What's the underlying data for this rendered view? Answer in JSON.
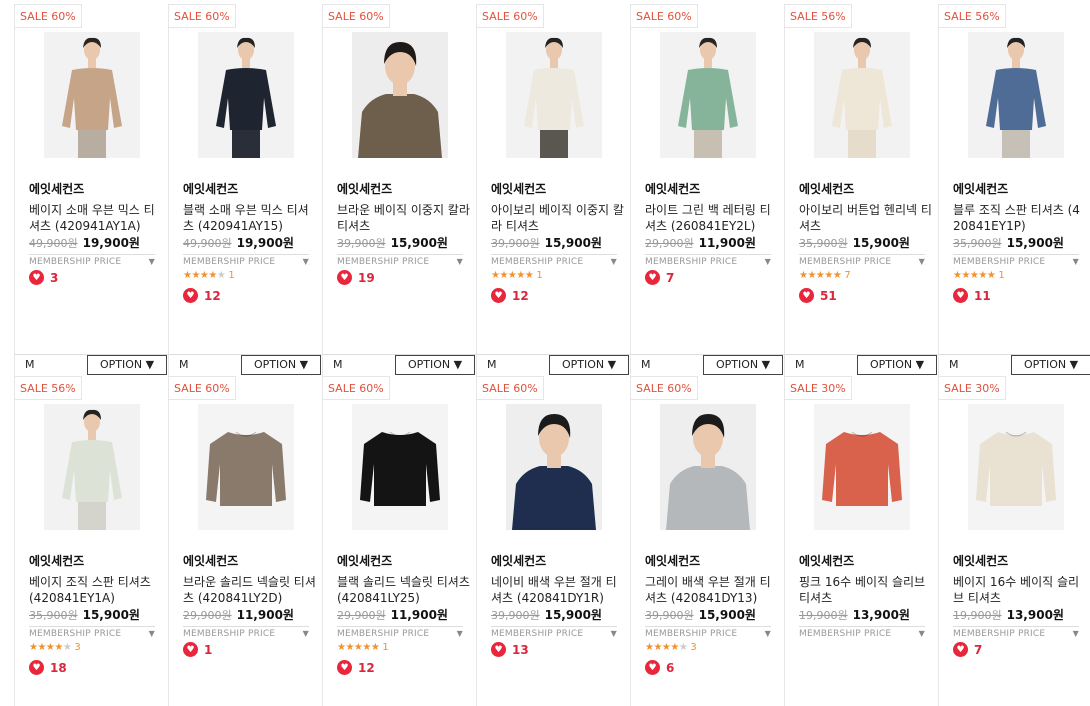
{
  "membership_label": "MEMBERSHIP PRICE",
  "option_label": "OPTION ▼",
  "products": [
    {
      "sale": "SALE 60%",
      "brand": "에잇세컨즈",
      "name": "베이지 소매 우븐 믹스 티셔츠 (420941AY1A)",
      "orig": "49,900원",
      "price": "19,900원",
      "rating": 0,
      "reviews": "",
      "likes": "3",
      "size": "M",
      "colors": {
        "top": "#c5a487",
        "bg": "#f2f2f2",
        "skin": "#e9c8ad",
        "hair": "#2a2420",
        "pants": "#b7ada0"
      },
      "style": "model"
    },
    {
      "sale": "SALE 60%",
      "brand": "에잇세컨즈",
      "name": "블랙 소매 우븐 믹스 티셔츠 (420941AY15)",
      "orig": "49,900원",
      "price": "19,900원",
      "rating": 4,
      "reviews": "1",
      "likes": "12",
      "size": "M",
      "colors": {
        "top": "#1e2430",
        "bg": "#f2f2f2",
        "skin": "#e9c8ad",
        "hair": "#222",
        "pants": "#2a2e38"
      },
      "style": "model"
    },
    {
      "sale": "SALE 60%",
      "brand": "에잇세컨즈",
      "name": "브라운 베이직 이중지 칼라 티셔츠",
      "orig": "39,900원",
      "price": "15,900원",
      "rating": 0,
      "reviews": "",
      "likes": "19",
      "size": "M",
      "colors": {
        "top": "#6e5e4c",
        "bg": "#ededed",
        "skin": "#e9c8ad",
        "hair": "#1f1a17",
        "pants": "#6e5e4c"
      },
      "style": "close"
    },
    {
      "sale": "SALE 60%",
      "brand": "에잇세컨즈",
      "name": "아이보리 베이직 이중지 칼라 티셔츠",
      "orig": "39,900원",
      "price": "15,900원",
      "rating": 5,
      "reviews": "1",
      "likes": "12",
      "size": "M",
      "colors": {
        "top": "#ede9df",
        "bg": "#f2f2f2",
        "skin": "#e9c8ad",
        "hair": "#222",
        "pants": "#5a5650"
      },
      "style": "model"
    },
    {
      "sale": "SALE 60%",
      "brand": "에잇세컨즈",
      "name": "라이트 그린 백 레터링 티셔츠 (260841EY2L)",
      "orig": "29,900원",
      "price": "11,900원",
      "rating": 0,
      "reviews": "",
      "likes": "7",
      "size": "M",
      "colors": {
        "top": "#86b49b",
        "bg": "#f2f2f2",
        "skin": "#e9c8ad",
        "hair": "#2a2420",
        "pants": "#c7c0b2"
      },
      "style": "model"
    },
    {
      "sale": "SALE 56%",
      "brand": "에잇세컨즈",
      "name": "아이보리 버튼업 헨리넥 티셔츠",
      "orig": "35,900원",
      "price": "15,900원",
      "rating": 5,
      "reviews": "7",
      "likes": "51",
      "size": "M",
      "colors": {
        "top": "#eee6d6",
        "bg": "#f2f2f2",
        "skin": "#e9c8ad",
        "hair": "#2a2420",
        "pants": "#e6dccb"
      },
      "style": "model"
    },
    {
      "sale": "SALE 56%",
      "brand": "에잇세컨즈",
      "name": "블루 조직 스판 티셔츠 (420841EY1P)",
      "orig": "35,900원",
      "price": "15,900원",
      "rating": 5,
      "reviews": "1",
      "likes": "11",
      "size": "M",
      "colors": {
        "top": "#4e6c96",
        "bg": "#f2f2f2",
        "skin": "#e9c8ad",
        "hair": "#222",
        "pants": "#c6c0b6"
      },
      "style": "model"
    },
    {
      "sale": "SALE 56%",
      "brand": "에잇세컨즈",
      "name": "베이지 조직 스판 티셔츠 (420841EY1A)",
      "orig": "35,900원",
      "price": "15,900원",
      "rating": 4,
      "reviews": "3",
      "likes": "18",
      "size": "",
      "colors": {
        "top": "#dde2d6",
        "bg": "#f2f2f2",
        "skin": "#e9c8ad",
        "hair": "#222",
        "pants": "#d4d4cc"
      },
      "style": "model"
    },
    {
      "sale": "SALE 60%",
      "brand": "에잇세컨즈",
      "name": "브라운 솔리드 넥슬릿 티셔츠 (420841LY2D)",
      "orig": "29,900원",
      "price": "11,900원",
      "rating": 0,
      "reviews": "",
      "likes": "1",
      "size": "",
      "colors": {
        "top": "#8a7a6c",
        "bg": "#f4f4f4"
      },
      "style": "flat"
    },
    {
      "sale": "SALE 60%",
      "brand": "에잇세컨즈",
      "name": "블랙 솔리드 넥슬릿 티셔츠 (420841LY25)",
      "orig": "29,900원",
      "price": "11,900원",
      "rating": 5,
      "reviews": "1",
      "likes": "12",
      "size": "",
      "colors": {
        "top": "#141414",
        "bg": "#f4f4f4"
      },
      "style": "flat"
    },
    {
      "sale": "SALE 60%",
      "brand": "에잇세컨즈",
      "name": "네이비 배색 우븐 절개 티셔츠 (420841DY1R)",
      "orig": "39,900원",
      "price": "15,900원",
      "rating": 0,
      "reviews": "",
      "likes": "13",
      "size": "",
      "colors": {
        "top": "#1f2e4e",
        "bg": "#eeeeee",
        "skin": "#e9c8ad",
        "hair": "#1b1b1b",
        "pants": "#1f2e4e"
      },
      "style": "close"
    },
    {
      "sale": "SALE 60%",
      "brand": "에잇세컨즈",
      "name": "그레이 배색 우븐 절개 티셔츠 (420841DY13)",
      "orig": "39,900원",
      "price": "15,900원",
      "rating": 4,
      "reviews": "3",
      "likes": "6",
      "size": "",
      "colors": {
        "top": "#b4b8bb",
        "bg": "#eeeeee",
        "skin": "#e9c8ad",
        "hair": "#1b1b1b",
        "pants": "#b4b8bb"
      },
      "style": "close"
    },
    {
      "sale": "SALE 30%",
      "brand": "에잇세컨즈",
      "name": "핑크 16수 베이직 슬리브 티셔츠",
      "orig": "19,900원",
      "price": "13,900원",
      "rating": 0,
      "reviews": "",
      "likes": "",
      "size": "",
      "colors": {
        "top": "#d8624c",
        "bg": "#f4f4f4"
      },
      "style": "flat"
    },
    {
      "sale": "SALE 30%",
      "brand": "에잇세컨즈",
      "name": "베이지 16수 베이직 슬리브 티셔츠",
      "orig": "19,900원",
      "price": "13,900원",
      "rating": 0,
      "reviews": "",
      "likes": "7",
      "size": "",
      "colors": {
        "top": "#e9e2d3",
        "bg": "#f4f4f4"
      },
      "style": "flat"
    }
  ]
}
